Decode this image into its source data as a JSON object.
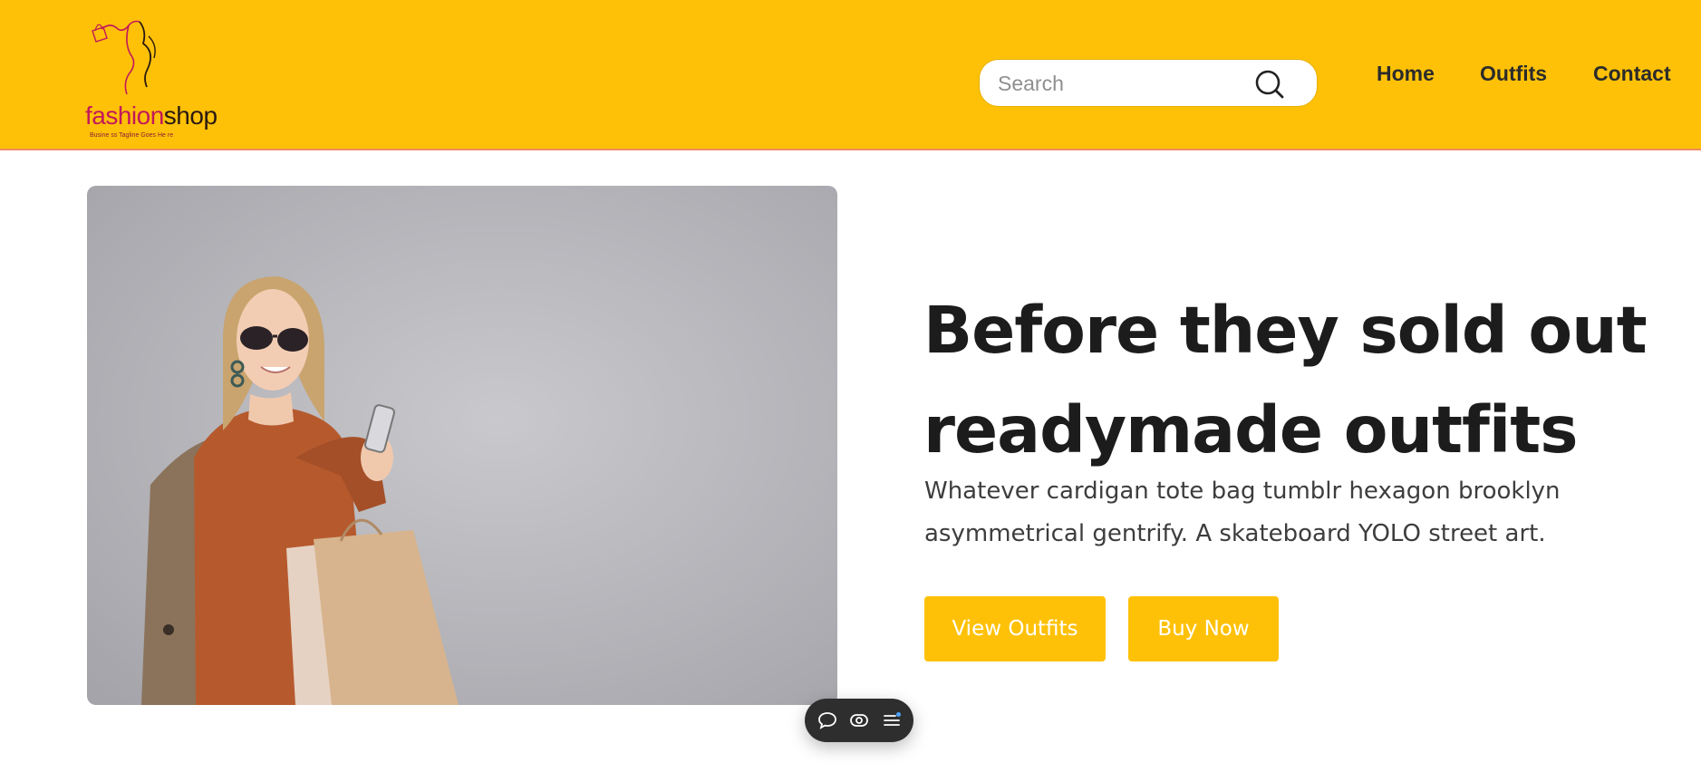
{
  "header": {
    "logo": {
      "text_part1": "fashion",
      "text_part2": "shop",
      "tagline": "Busine ss Tagline Goes He re"
    },
    "search": {
      "placeholder": "Search",
      "value": "",
      "icon": "search-icon"
    },
    "nav": [
      {
        "label": "Home"
      },
      {
        "label": "Outfits"
      },
      {
        "label": "Contact"
      }
    ]
  },
  "hero": {
    "image": "woman-shopping-photo",
    "headline_line1": "Before they sold out",
    "headline_line2": "readymade outfits",
    "subtext_line1": "Whatever cardigan tote bag tumblr hexagon brooklyn",
    "subtext_line2": "asymmetrical gentrify. A skateboard YOLO street art.",
    "primary_button": "View Outfits",
    "secondary_button": "Buy Now"
  },
  "floating_toolbar": {
    "icons": [
      "comment-icon",
      "eye-icon",
      "menu-icon"
    ]
  },
  "colors": {
    "brand": "#ffc107",
    "header_border": "#f08a60",
    "text_dark": "#1c1c1c",
    "text_body": "#3d3d3d",
    "logo_pink": "#c2185b"
  }
}
